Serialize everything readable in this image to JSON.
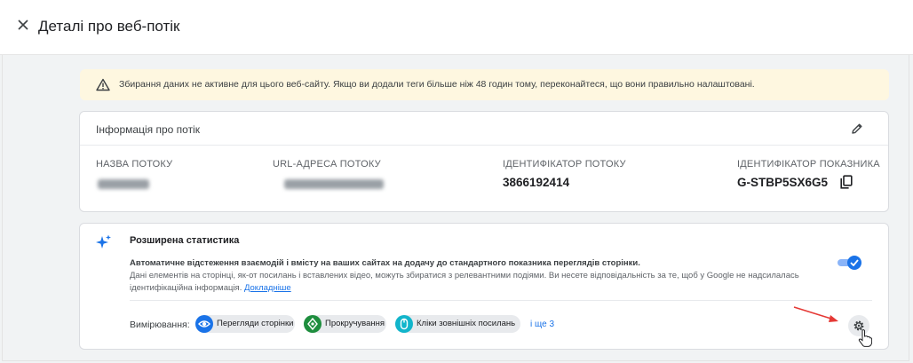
{
  "header": {
    "title": "Деталі про веб-потік"
  },
  "warning": {
    "text": "Збирання даних не активне для цього веб-сайту. Якщо ви додали теги більше ніж 48 годин тому, переконайтеся, що вони правильно налаштовані."
  },
  "stream_info": {
    "title": "Інформація про потік",
    "columns": [
      {
        "label": "НАЗВА ПОТОКУ",
        "value": ""
      },
      {
        "label": "URL-АДРЕСА ПОТОКУ",
        "value": ""
      },
      {
        "label": "ІДЕНТИФІКАТОР ПОТОКУ",
        "value": "3866192414"
      },
      {
        "label": "ІДЕНТИФІКАТОР ПОКАЗНИКА",
        "value": "G-STBP5SX6G5"
      }
    ]
  },
  "enhanced": {
    "title": "Розширена статистика",
    "desc1": "Автоматичне відстеження взаємодій і вмісту на ваших сайтах на додачу до стандартного показника переглядів сторінки.",
    "desc2": "Дані елементів на сторінці, як-от посилань і вставлених відео, можуть збиратися з релевантними подіями. Ви несете відповідальність за те, щоб у Google не надсилалась",
    "desc3": "ідентифікаційна інформація.",
    "learn_more": "Докладніше",
    "toggle_on": true,
    "measurement_label": "Вимірювання:",
    "chips": [
      {
        "label": "Перегляди сторінки",
        "icon": "eye-icon",
        "color": "#1a73e8"
      },
      {
        "label": "Прокручування",
        "icon": "scroll-icon",
        "color": "#1e8e3e"
      },
      {
        "label": "Кліки зовнішніх посилань",
        "icon": "mouse-icon",
        "color": "#12b5cb"
      }
    ],
    "more_link": "і ще 3"
  },
  "colors": {
    "accent": "#1a73e8",
    "warning_bg": "#fef7e0",
    "page_bg": "#f1f3f4",
    "arrow": "#e53935"
  }
}
